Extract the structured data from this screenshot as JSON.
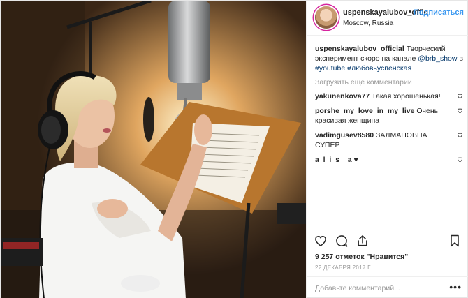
{
  "header": {
    "username": "uspenskayalubov_offic",
    "separator": "•",
    "follow_label": "Подписаться",
    "location": "Moscow, Russia"
  },
  "caption": {
    "username": "uspenskayalubov_official",
    "text_before": " Творческий эксперимент скоро на канале ",
    "mention": "@brb_show",
    "text_mid": " в ",
    "hashtag1": "#youtube",
    "hashtag2": "#любовьуспенская"
  },
  "load_more_label": "Загрузить еще комментарии",
  "comments": [
    {
      "username": "yakunenkova77",
      "text": " Такая хорошенькая!"
    },
    {
      "username": "porshe_my_love_in_my_live",
      "text": " Очень красивая женщина"
    },
    {
      "username": "vadimgusev8580",
      "text": " ЗАЛМАНОВНА СУПЕР"
    },
    {
      "username": "a_l_i_s__a",
      "text": " ♥"
    }
  ],
  "likes_text": "9 257 отметок \"Нравится\"",
  "date_text": "22 декабря 2017 г.",
  "add_comment_placeholder": "Добавьте комментарий...",
  "more_label": "•••",
  "icons": {
    "like": "heart-icon",
    "comment": "comment-bubble-icon",
    "share": "share-icon",
    "save": "bookmark-icon"
  },
  "colors": {
    "link": "#003569",
    "follow": "#3897f0",
    "muted": "#999999",
    "text": "#262626"
  }
}
